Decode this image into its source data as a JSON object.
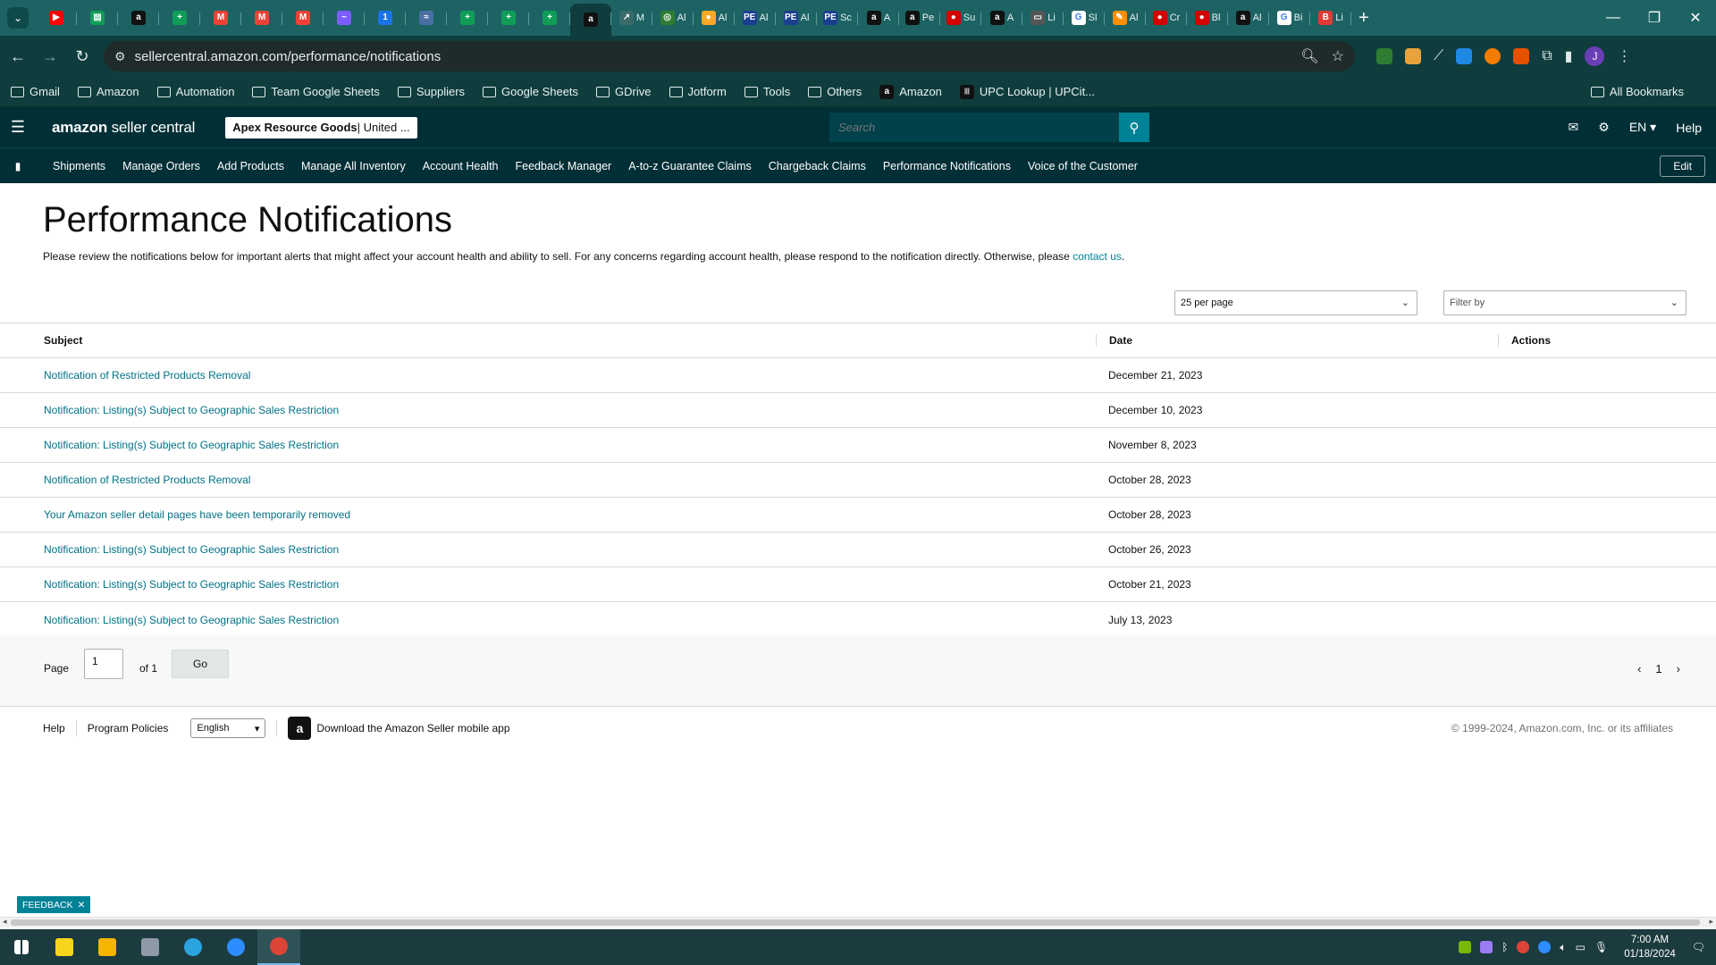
{
  "browser": {
    "tabs": [
      {
        "icon": "youtube-icon",
        "color": "#ff0000",
        "glyph": "▶",
        "label": ""
      },
      {
        "icon": "sheets-icon",
        "color": "#0f9d58",
        "glyph": "▤",
        "label": ""
      },
      {
        "icon": "amazon-icon",
        "color": "#111111",
        "glyph": "a",
        "label": ""
      },
      {
        "icon": "sheets-icon",
        "color": "#0f9d58",
        "glyph": "+",
        "label": ""
      },
      {
        "icon": "gmail-icon",
        "color": "#ea4335",
        "glyph": "M",
        "label": ""
      },
      {
        "icon": "gmail-icon",
        "color": "#ea4335",
        "glyph": "M",
        "label": ""
      },
      {
        "icon": "gmail-icon",
        "color": "#ea4335",
        "glyph": "M",
        "label": ""
      },
      {
        "icon": "messenger-icon",
        "color": "#7b5cff",
        "glyph": "~",
        "label": ""
      },
      {
        "icon": "info-icon",
        "color": "#1a73e8",
        "glyph": "1",
        "label": ""
      },
      {
        "icon": "chart-icon",
        "color": "#4a6fa5",
        "glyph": "≈",
        "label": ""
      },
      {
        "icon": "sheets-icon",
        "color": "#0f9d58",
        "glyph": "+",
        "label": ""
      },
      {
        "icon": "sheets-icon",
        "color": "#0f9d58",
        "glyph": "+",
        "label": ""
      },
      {
        "icon": "sheets-icon",
        "color": "#0f9d58",
        "glyph": "+",
        "label": ""
      },
      {
        "icon": "amazon-icon",
        "color": "#111111",
        "glyph": "a",
        "label": "",
        "active": true
      },
      {
        "icon": "ext-icon",
        "color": "#3a6a6a",
        "glyph": "↗",
        "label": "M"
      },
      {
        "icon": "ext-icon",
        "color": "#2e7d32",
        "glyph": "◎",
        "label": "Al"
      },
      {
        "icon": "ext-icon",
        "color": "#f9a825",
        "glyph": "●",
        "label": "Al"
      },
      {
        "icon": "pe-icon",
        "color": "#1a3f8f",
        "glyph": "PE",
        "label": "Al"
      },
      {
        "icon": "pe-icon",
        "color": "#1a3f8f",
        "glyph": "PE",
        "label": "Al"
      },
      {
        "icon": "pe-icon",
        "color": "#1a3f8f",
        "glyph": "PE",
        "label": "Sc"
      },
      {
        "icon": "amazon-icon",
        "color": "#111111",
        "glyph": "a",
        "label": "A"
      },
      {
        "icon": "amazon-icon",
        "color": "#111111",
        "glyph": "a",
        "label": "Pe"
      },
      {
        "icon": "stop-icon",
        "color": "#d50000",
        "glyph": "●",
        "label": "Su"
      },
      {
        "icon": "amazon-icon",
        "color": "#111111",
        "glyph": "a",
        "label": "A"
      },
      {
        "icon": "barcode-icon",
        "color": "#555555",
        "glyph": "▭",
        "label": "Li"
      },
      {
        "icon": "google-icon",
        "color": "#ffffff",
        "glyph": "G",
        "label": "Sl"
      },
      {
        "icon": "pen-icon",
        "color": "#ff8f00",
        "glyph": "✎",
        "label": "Al"
      },
      {
        "icon": "stop-icon",
        "color": "#d50000",
        "glyph": "●",
        "label": "Cr"
      },
      {
        "icon": "stop-icon",
        "color": "#d50000",
        "glyph": "●",
        "label": "Bl"
      },
      {
        "icon": "amazon-icon",
        "color": "#111111",
        "glyph": "a",
        "label": "Al"
      },
      {
        "icon": "google-icon",
        "color": "#ffffff",
        "glyph": "G",
        "label": "Bi"
      },
      {
        "icon": "b-icon",
        "color": "#e53935",
        "glyph": "B",
        "label": "Li"
      }
    ],
    "url": "sellercentral.amazon.com/performance/notifications",
    "bookmarks": [
      {
        "label": "Gmail",
        "type": "folder"
      },
      {
        "label": "Amazon",
        "type": "folder"
      },
      {
        "label": "Automation",
        "type": "folder"
      },
      {
        "label": "Team Google Sheets",
        "type": "folder"
      },
      {
        "label": "Suppliers",
        "type": "folder"
      },
      {
        "label": "Google Sheets",
        "type": "folder"
      },
      {
        "label": "GDrive",
        "type": "folder"
      },
      {
        "label": "Jotform",
        "type": "folder"
      },
      {
        "label": "Tools",
        "type": "folder"
      },
      {
        "label": "Others",
        "type": "folder"
      },
      {
        "label": "Amazon",
        "type": "site"
      },
      {
        "label": "UPC Lookup | UPCit...",
        "type": "site"
      }
    ],
    "all_bookmarks": "All Bookmarks",
    "profile_initial": "J"
  },
  "seller": {
    "logo_main": "amazon",
    "logo_rest": " seller central",
    "store_name": "Apex Resource Goods",
    "store_market": " | United ...",
    "search_placeholder": "Search",
    "lang": "EN ▾",
    "help": "Help",
    "nav": [
      "Shipments",
      "Manage Orders",
      "Add Products",
      "Manage All Inventory",
      "Account Health",
      "Feedback Manager",
      "A-to-z Guarantee Claims",
      "Chargeback Claims",
      "Performance Notifications",
      "Voice of the Customer"
    ],
    "edit": "Edit"
  },
  "page": {
    "title": "Performance Notifications",
    "intro": "Please review the notifications below for important alerts that might affect your account health and ability to sell. For any concerns regarding account health, please respond to the notification directly. Otherwise, please ",
    "intro_link": "contact us",
    "intro_end": ".",
    "per_page": "25 per page",
    "filter_by": "Filter by",
    "columns": {
      "subject": "Subject",
      "date": "Date",
      "actions": "Actions"
    },
    "rows": [
      {
        "subject": "Notification of Restricted Products Removal",
        "date": "December 21, 2023"
      },
      {
        "subject": "Notification: Listing(s) Subject to Geographic Sales Restriction",
        "date": "December 10, 2023"
      },
      {
        "subject": "Notification: Listing(s) Subject to Geographic Sales Restriction",
        "date": "November 8, 2023"
      },
      {
        "subject": "Notification of Restricted Products Removal",
        "date": "October 28, 2023"
      },
      {
        "subject": "Your Amazon seller detail pages have been temporarily removed",
        "date": "October 28, 2023"
      },
      {
        "subject": "Notification: Listing(s) Subject to Geographic Sales Restriction",
        "date": "October 26, 2023"
      },
      {
        "subject": "Notification: Listing(s) Subject to Geographic Sales Restriction",
        "date": "October 21, 2023"
      },
      {
        "subject": "Notification: Listing(s) Subject to Geographic Sales Restriction",
        "date": "July 13, 2023"
      }
    ],
    "pager": {
      "label": "Page",
      "value": "1",
      "of": "of 1",
      "go": "Go",
      "current": "1"
    }
  },
  "footer": {
    "help": "Help",
    "policies": "Program Policies",
    "language": "English",
    "app": "Download the Amazon Seller mobile app",
    "copyright": "© 1999-2024, Amazon.com, Inc. or its affiliates"
  },
  "feedback": "FEEDBACK",
  "taskbar": {
    "apps": [
      {
        "icon": "windows-start-icon",
        "color": "#ffffff"
      },
      {
        "icon": "sticky-notes-icon",
        "color": "#f7d51d"
      },
      {
        "icon": "file-explorer-icon",
        "color": "#f4b400"
      },
      {
        "icon": "calculator-icon",
        "color": "#8e9aa6"
      },
      {
        "icon": "telegram-icon",
        "color": "#2aa3df"
      },
      {
        "icon": "zoom-icon",
        "color": "#2d8cff"
      },
      {
        "icon": "chrome-icon",
        "color": "#db4437",
        "active": true
      }
    ],
    "time": "7:00 AM",
    "date": "01/18/2024"
  }
}
